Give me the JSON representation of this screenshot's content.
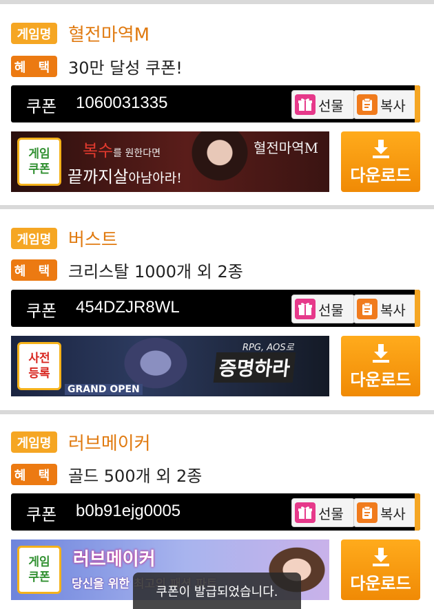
{
  "labels": {
    "game_tag": "게임명",
    "benefit_tag": "혜 택",
    "coupon_label": "쿠폰",
    "gift_button": "선물",
    "copy_button": "복사",
    "download_button": "다운로드"
  },
  "cards": [
    {
      "game": "혈전마역M",
      "benefit": "30만 달성 쿠폰!",
      "coupon": "1060031335",
      "banner_badge": [
        "게임",
        "쿠폰"
      ],
      "banner_badge_color": "#2f8f2f",
      "banner_text_1": "복수",
      "banner_text_1b": "를 원한다면",
      "banner_text_2": "끝까지살",
      "banner_text_2b": "아남아라!",
      "banner_logo": "혈전마역M",
      "banner_colors": [
        "#3a1512",
        "#6a2420"
      ]
    },
    {
      "game": "버스트",
      "benefit": "크리스탈 1000개 외 2종",
      "coupon": "454DZJR8WL",
      "banner_badge": [
        "사전",
        "등록"
      ],
      "banner_badge_color": "#d8261f",
      "banner_text_1": "RPG, AOS로",
      "banner_text_2": "증명하라",
      "banner_open": "GRAND OPEN",
      "banner_colors": [
        "#101a2e",
        "#2a3550"
      ]
    },
    {
      "game": "러브메이커",
      "benefit": "골드 500개 외 2종",
      "coupon": "b0b91ejg0005",
      "banner_badge": [
        "게임",
        "쿠폰"
      ],
      "banner_badge_color": "#2f8f2f",
      "banner_text_1": "러브메이커",
      "banner_text_2": "당신을 위한 최고의 패션 파트",
      "banner_colors": [
        "#6b7fd6",
        "#b9a3e6"
      ]
    }
  ],
  "toast": "쿠폰이 발급되었습니다."
}
